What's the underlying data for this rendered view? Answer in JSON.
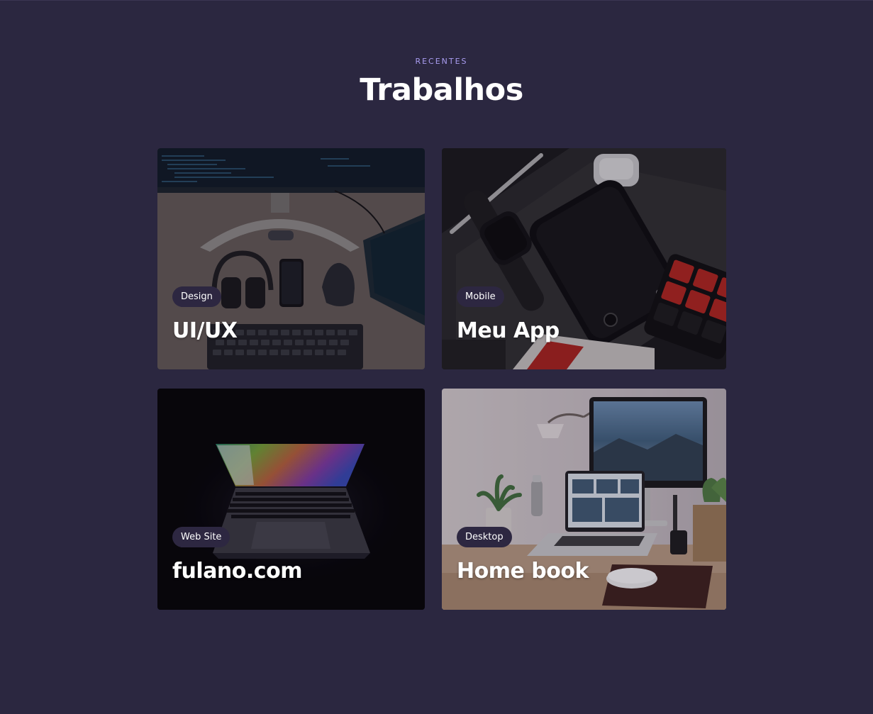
{
  "section": {
    "eyebrow": "RECENTES",
    "title": "Trabalhos"
  },
  "projects": [
    {
      "tag": "Design",
      "title": "UI/UX",
      "image": "desk-flatlay-headphones-keyboard-photo"
    },
    {
      "tag": "Mobile",
      "title": "Meu App",
      "image": "dark-desk-smartwatch-phone-rubiks-cube-photo"
    },
    {
      "tag": "Web Site",
      "title": "fulano.com",
      "image": "laptop-in-dark-colorful-screen-photo"
    },
    {
      "tag": "Desktop",
      "title": "Home book",
      "image": "home-office-imac-macbook-photo"
    }
  ],
  "colors": {
    "background": "#2b2740",
    "accent": "#a99cf0",
    "tag_background": "#2d2741"
  }
}
